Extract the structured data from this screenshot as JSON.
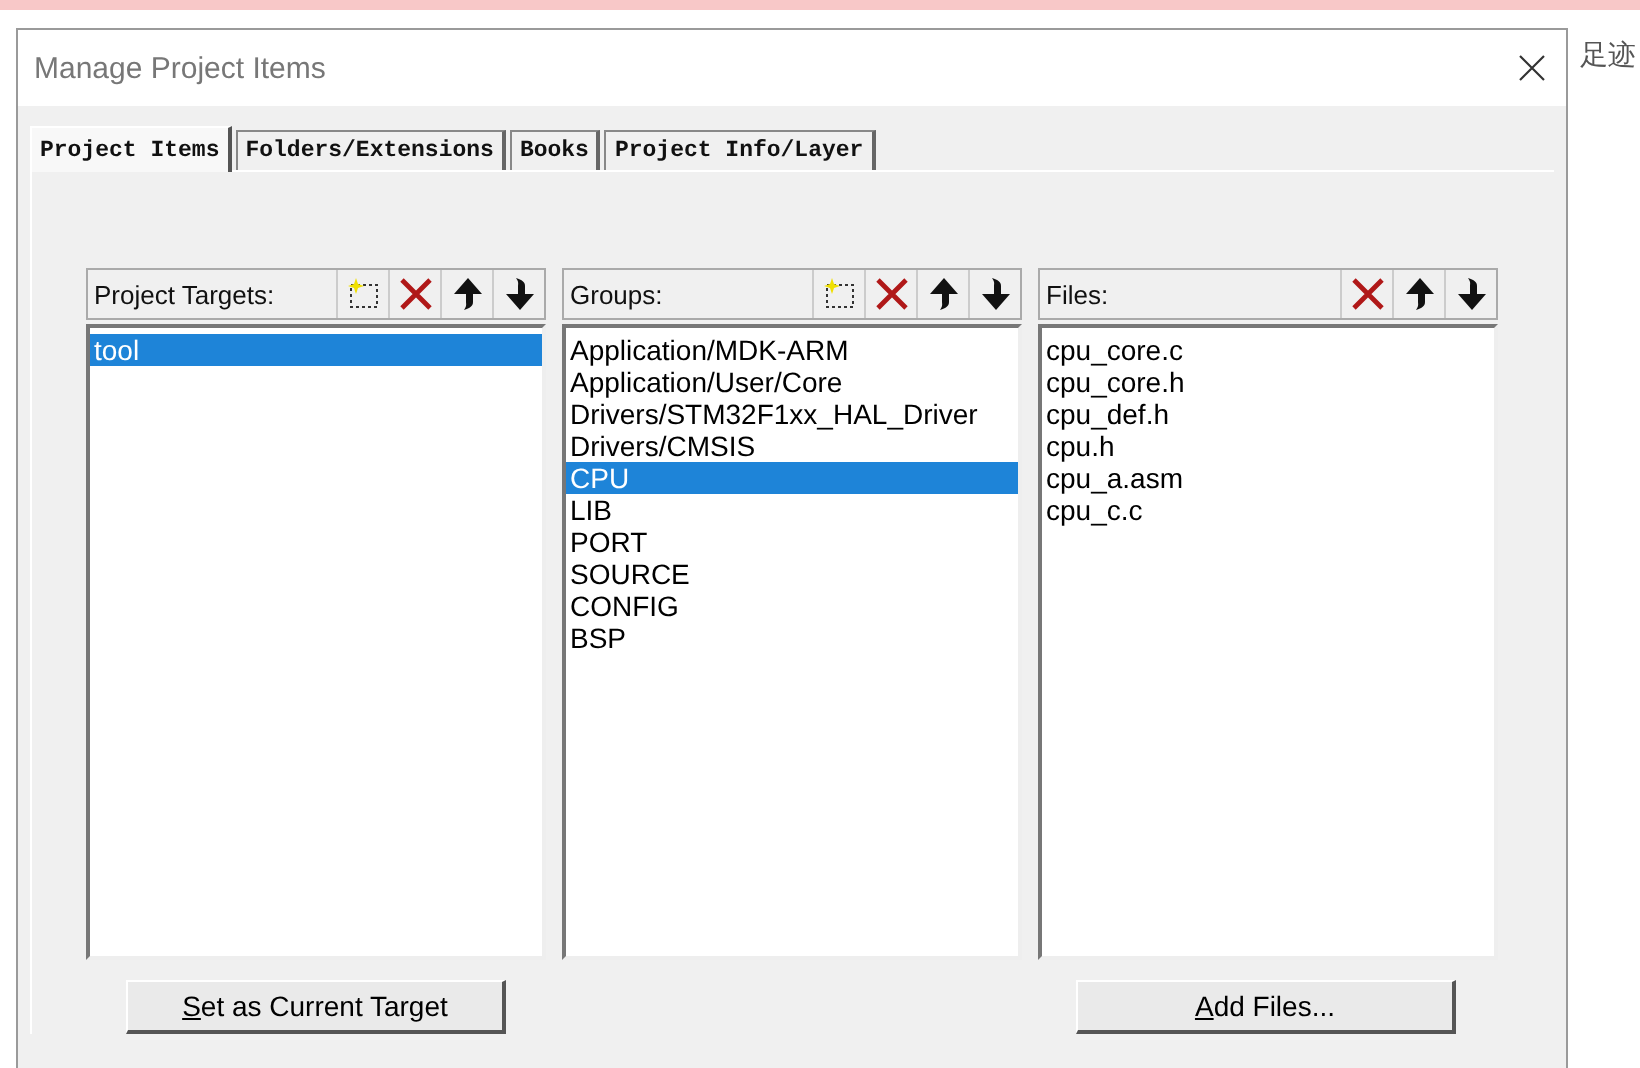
{
  "background_page": {
    "user_links": [
      "足迹"
    ]
  },
  "window": {
    "title": "Manage Project Items"
  },
  "tabs": [
    {
      "label": "Project Items",
      "selected": true
    },
    {
      "label": "Folders/Extensions",
      "selected": false
    },
    {
      "label": "Books",
      "selected": false
    },
    {
      "label": "Project Info/Layer",
      "selected": false
    }
  ],
  "panels": [
    {
      "title": "Project Targets:",
      "tools": [
        {
          "kind": "new"
        },
        {
          "kind": "delete"
        },
        {
          "kind": "up"
        },
        {
          "kind": "down"
        }
      ],
      "items": [
        {
          "label": "tool",
          "selected": true
        }
      ]
    },
    {
      "title": "Groups:",
      "tools": [
        {
          "kind": "new"
        },
        {
          "kind": "delete"
        },
        {
          "kind": "up"
        },
        {
          "kind": "down"
        }
      ],
      "items": [
        {
          "label": "Application/MDK-ARM",
          "selected": false
        },
        {
          "label": "Application/User/Core",
          "selected": false
        },
        {
          "label": "Drivers/STM32F1xx_HAL_Driver",
          "selected": false
        },
        {
          "label": "Drivers/CMSIS",
          "selected": false
        },
        {
          "label": "CPU",
          "selected": true
        },
        {
          "label": "LIB",
          "selected": false
        },
        {
          "label": "PORT",
          "selected": false
        },
        {
          "label": "SOURCE",
          "selected": false
        },
        {
          "label": "CONFIG",
          "selected": false
        },
        {
          "label": "BSP",
          "selected": false
        }
      ]
    },
    {
      "title": "Files:",
      "tools": [
        {
          "kind": "delete"
        },
        {
          "kind": "up"
        },
        {
          "kind": "down"
        }
      ],
      "items": [
        {
          "label": "cpu_core.c",
          "selected": false
        },
        {
          "label": "cpu_core.h",
          "selected": false
        },
        {
          "label": "cpu_def.h",
          "selected": false
        },
        {
          "label": "cpu.h",
          "selected": false
        },
        {
          "label": "cpu_a.asm",
          "selected": false
        },
        {
          "label": "cpu_c.c",
          "selected": false
        }
      ]
    }
  ],
  "buttons": [
    {
      "label": "Set as Current Target"
    },
    {
      "label": "Add Files..."
    }
  ]
}
